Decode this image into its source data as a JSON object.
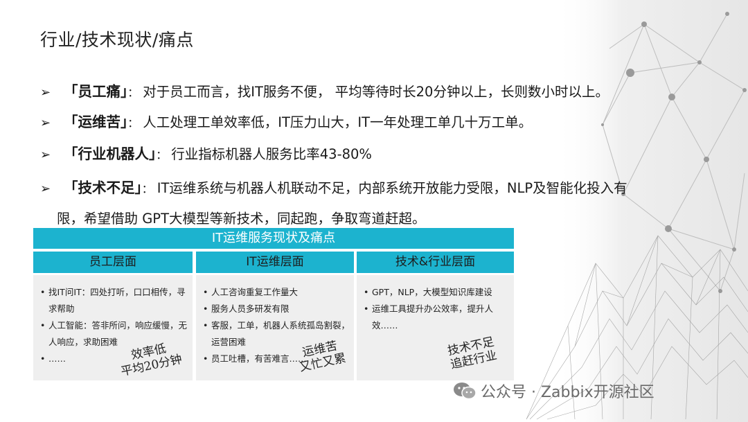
{
  "slide": {
    "title": "行业/技术现状/痛点",
    "bullets": [
      {
        "key": "「员工痛」",
        "sep": "：",
        "text": "对于员工而言，找IT服务不便， 平均等待时长20分钟以上，长则数小时以上。"
      },
      {
        "key": "「运维苦」",
        "sep": "：",
        "text": "人工处理工单效率低，IT压力山大，IT一年处理工单几十万工单。"
      },
      {
        "key": "「行业机器人」",
        "sep": "：",
        "text": "行业指标机器人服务比率43-80%"
      },
      {
        "key": "「技术不足」",
        "sep": "：",
        "text": "IT运维系统与机器人机联动不足，内部系统开放能力受限，NLP及智能化投入有",
        "continuation": "限，希望借助 GPT大模型等新技术，同起跑，争取弯道赶超。"
      }
    ],
    "bullet_marker": "➢"
  },
  "table": {
    "title": "IT运维服务现状及痛点",
    "columns": [
      {
        "header": "员工层面",
        "items": [
          "找IT问IT：四处打听，口口相传，寻求帮助",
          "人工智能：答非所问，响应缓慢，无人响应，求助困难",
          "……"
        ],
        "note": [
          "效率低",
          "平均20分钟"
        ]
      },
      {
        "header": "IT运维层面",
        "items": [
          "人工咨询重复工作量大",
          "服务人员多研发有限",
          "客服，工单，机器人系统孤岛割裂，运营困难",
          "员工吐槽，有苦难言……"
        ],
        "note": [
          "运维苦",
          "又忙又累"
        ]
      },
      {
        "header": "技术&行业层面",
        "items": [
          "GPT，NLP，大模型知识库建设",
          "运维工具提升办公效率，提升人效……"
        ],
        "note": [
          "技术不足",
          "追赶行业"
        ]
      }
    ]
  },
  "watermark": {
    "text": "公众号 · Zabbix开源社区",
    "icon": "wechat-icon"
  },
  "colors": {
    "accent": "#1cb3cf",
    "cell_bg": "#efefef",
    "side_bg": "#ececec"
  }
}
